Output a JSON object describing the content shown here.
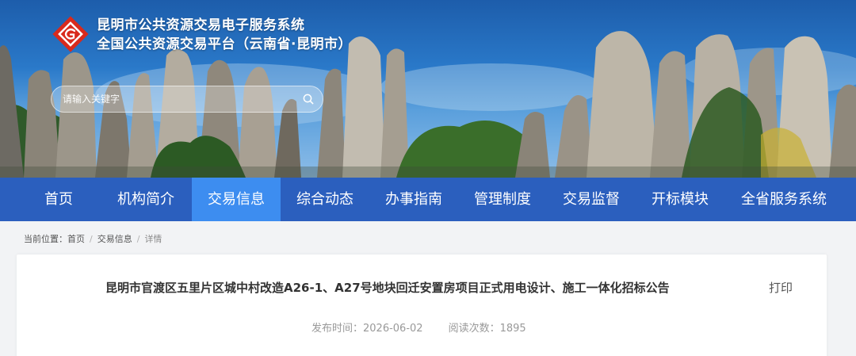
{
  "site": {
    "title_line1": "昆明市公共资源交易电子服务系统",
    "title_line2": "全国公共资源交易平台（云南省·昆明市）"
  },
  "search": {
    "placeholder": "请输入关键字"
  },
  "nav": {
    "items": [
      {
        "label": "首页"
      },
      {
        "label": "机构简介"
      },
      {
        "label": "交易信息"
      },
      {
        "label": "综合动态"
      },
      {
        "label": "办事指南"
      },
      {
        "label": "管理制度"
      },
      {
        "label": "交易监督"
      },
      {
        "label": "开标模块"
      },
      {
        "label": "全省服务系统"
      }
    ],
    "active": "交易信息",
    "colors": {
      "bar": "#2b5fbe",
      "active": "#3d8df0"
    }
  },
  "breadcrumb": {
    "prefix": "当前位置：",
    "items": [
      "首页",
      "交易信息",
      "详情"
    ],
    "separator": "/"
  },
  "article": {
    "title": "昆明市官渡区五里片区城中村改造A26-1、A27号地块回迁安置房项目正式用电设计、施工一体化招标公告",
    "print_label": "打印",
    "publish_label": "发布时间：2026-06-02",
    "views_label": "阅读次数：1895"
  },
  "icons": {
    "logo": "diamond-g-logo-icon",
    "search": "search-icon"
  }
}
